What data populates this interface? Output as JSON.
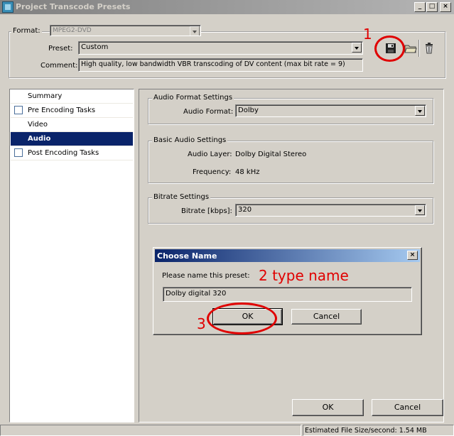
{
  "window": {
    "title": "Project Transcode Presets",
    "controls": [
      "_",
      "□",
      "×"
    ]
  },
  "top": {
    "format_label": "Format:",
    "format_value": "MPEG2-DVD",
    "preset_label": "Preset:",
    "preset_value": "Custom",
    "comment_label": "Comment:",
    "comment_value": "High quality, low bandwidth VBR transcoding of DV content (max bit rate = 9)"
  },
  "toolbar": {
    "icons": [
      "save-icon",
      "open-folder-icon",
      "delete-icon"
    ]
  },
  "sidebar": {
    "items": [
      {
        "label": "Summary",
        "checkbox": false,
        "selected": false
      },
      {
        "label": "Pre Encoding Tasks",
        "checkbox": true,
        "selected": false
      },
      {
        "label": "Video",
        "checkbox": false,
        "selected": false
      },
      {
        "label": "Audio",
        "checkbox": false,
        "selected": true
      },
      {
        "label": "Post Encoding Tasks",
        "checkbox": true,
        "selected": false
      }
    ]
  },
  "audio_format": {
    "title": "Audio Format Settings",
    "label": "Audio Format:",
    "value": "Dolby"
  },
  "basic_audio": {
    "title": "Basic Audio Settings",
    "layer_label": "Audio Layer:",
    "layer_value": "Dolby Digital Stereo",
    "freq_label": "Frequency:",
    "freq_value": "48 kHz"
  },
  "bitrate": {
    "title": "Bitrate Settings",
    "label": "Bitrate [kbps]:",
    "value": "320"
  },
  "dialog": {
    "title": "Choose Name",
    "prompt": "Please name this preset:",
    "input_value": "Dolby digital 320",
    "ok_label": "OK",
    "cancel_label": "Cancel"
  },
  "footer": {
    "ok_label": "OK",
    "cancel_label": "Cancel",
    "status": "Estimated File Size/second: 1.54 MB"
  },
  "annotations": {
    "one": "1",
    "two": "2  type name",
    "three": "3",
    "color": "#e00000"
  }
}
